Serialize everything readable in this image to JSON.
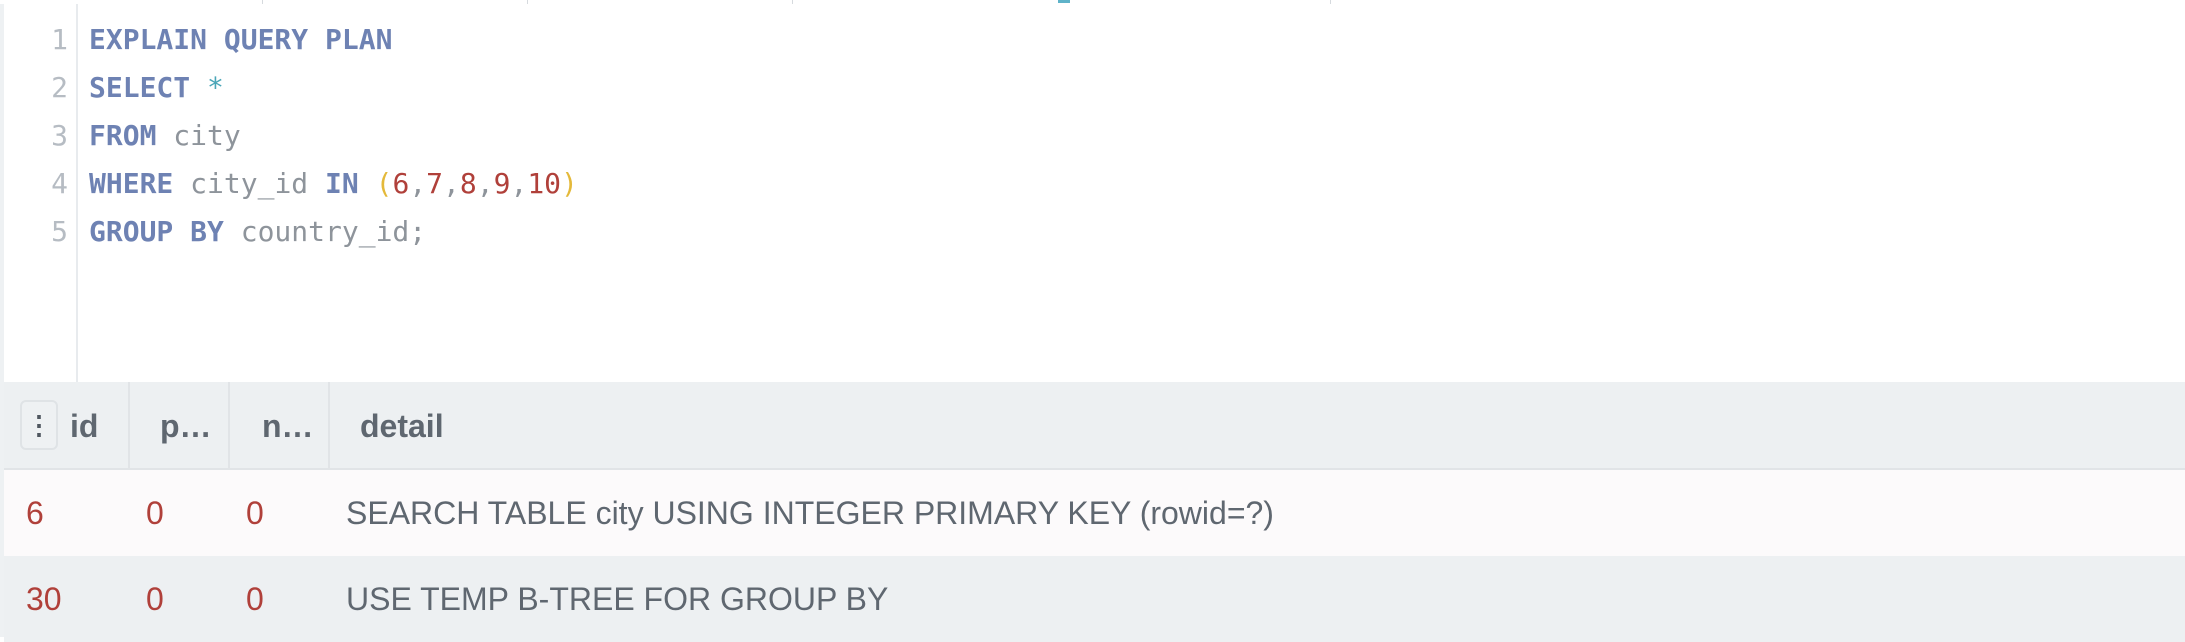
{
  "editor": {
    "line_numbers": [
      "1",
      "2",
      "3",
      "4",
      "5"
    ],
    "lines": [
      [
        {
          "t": "EXPLAIN QUERY PLAN",
          "c": "kw"
        }
      ],
      [
        {
          "t": "SELECT",
          "c": "kw"
        },
        {
          "t": " ",
          "c": "ident"
        },
        {
          "t": "*",
          "c": "op"
        }
      ],
      [
        {
          "t": "FROM",
          "c": "kw"
        },
        {
          "t": " city",
          "c": "ident"
        }
      ],
      [
        {
          "t": "WHERE",
          "c": "kw"
        },
        {
          "t": " city_id ",
          "c": "ident"
        },
        {
          "t": "IN",
          "c": "kw"
        },
        {
          "t": " ",
          "c": "ident"
        },
        {
          "t": "(",
          "c": "paren"
        },
        {
          "t": "6",
          "c": "num"
        },
        {
          "t": ",",
          "c": "ident"
        },
        {
          "t": "7",
          "c": "num"
        },
        {
          "t": ",",
          "c": "ident"
        },
        {
          "t": "8",
          "c": "num"
        },
        {
          "t": ",",
          "c": "ident"
        },
        {
          "t": "9",
          "c": "num"
        },
        {
          "t": ",",
          "c": "ident"
        },
        {
          "t": "10",
          "c": "num"
        },
        {
          "t": ")",
          "c": "paren"
        }
      ],
      [
        {
          "t": "GROUP BY",
          "c": "kw"
        },
        {
          "t": " country_id;",
          "c": "ident"
        }
      ]
    ]
  },
  "grid": {
    "menu_icon": "vertical-ellipsis-icon",
    "columns": [
      "id",
      "p…",
      "n…",
      "detail"
    ],
    "rows": [
      [
        "6",
        "0",
        "0",
        "SEARCH TABLE city USING INTEGER PRIMARY KEY (rowid=?)"
      ],
      [
        "30",
        "0",
        "0",
        "USE TEMP B-TREE FOR GROUP BY"
      ]
    ]
  },
  "colors": {
    "keyword": "#6e82b3",
    "number": "#b0403a",
    "paren": "#e4b93a",
    "operator": "#4aa6b8",
    "header_bg": "#edf0f2"
  }
}
